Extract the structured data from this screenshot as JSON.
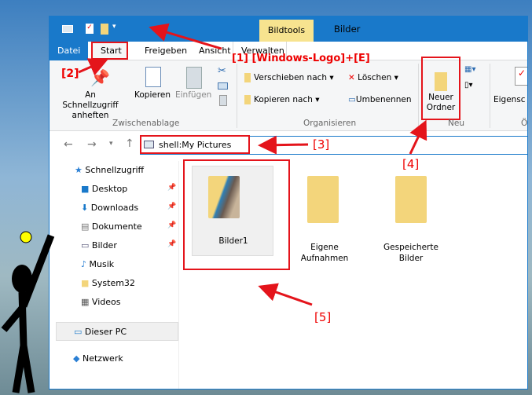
{
  "window": {
    "title": "Bilder",
    "contextual_tab": "Bildtools"
  },
  "tabs": [
    "Datei",
    "Start",
    "Freigeben",
    "Ansicht",
    "Verwalten"
  ],
  "ribbon": {
    "pin": "An Schnellzugriff anheften",
    "pin_l1": "An Schnellzugriff",
    "pin_l2": "anheften",
    "copy": "Kopieren",
    "paste": "Einfügen",
    "move_to": "Verschieben nach",
    "copy_to": "Kopieren nach",
    "delete": "Löschen",
    "rename": "Umbenennen",
    "new_folder_l1": "Neuer",
    "new_folder_l2": "Ordner",
    "properties": "Eigensc",
    "groups": [
      "Zwischenablage",
      "Organisieren",
      "Neu",
      "Ö"
    ]
  },
  "address": {
    "path": "shell:My Pictures"
  },
  "nav": {
    "quick_access": "Schnellzugriff",
    "items": [
      "Desktop",
      "Downloads",
      "Dokumente",
      "Bilder",
      "Musik",
      "System32",
      "Videos"
    ],
    "this_pc": "Dieser PC",
    "network": "Netzwerk"
  },
  "folders": [
    {
      "name": "Bilder1"
    },
    {
      "name": "Eigene Aufnahmen",
      "l1": "Eigene",
      "l2": "Aufnahmen"
    },
    {
      "name": "Gespeicherte Bilder",
      "l1": "Gespeicherte",
      "l2": "Bilder"
    }
  ],
  "annotations": {
    "a1": "[1]  [Windows-Logo]+[E]",
    "a2": "[2]",
    "a3": "[3]",
    "a4": "[4]",
    "a5": "[5]"
  },
  "colors": {
    "accent": "#1979ca",
    "annotation": "#e4141b",
    "folder": "#f3d57b"
  }
}
